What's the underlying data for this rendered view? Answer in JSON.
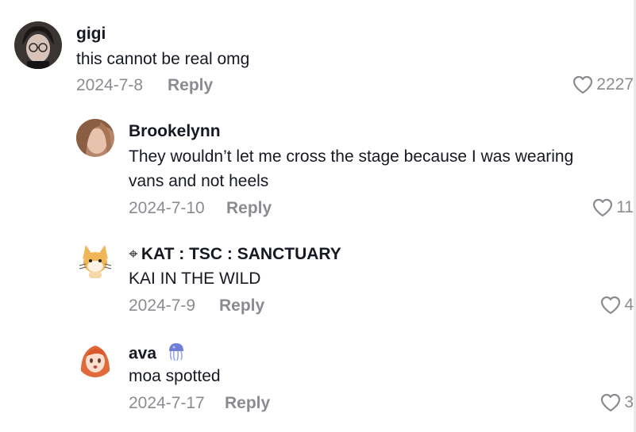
{
  "comments": [
    {
      "username": "gigi",
      "text": "this cannot be real omg",
      "date": "2024-7-8",
      "reply_label": "Reply",
      "likes": "2227",
      "avatar_icon": "person-photo-avatar"
    },
    {
      "username": "Brookelynn",
      "text": "They wouldn’t let me cross the stage because I was wearing vans and not heels",
      "date": "2024-7-10",
      "reply_label": "Reply",
      "likes": "11",
      "avatar_icon": "person-photo-avatar"
    },
    {
      "username": "KAT : TSC : SANCTUARY",
      "username_prefix_glyph": "⌖",
      "text": "KAI IN THE WILD",
      "date": "2024-7-9",
      "reply_label": "Reply",
      "likes": "4",
      "avatar_icon": "cartoon-fox-avatar"
    },
    {
      "username": "ava",
      "username_emoji": "jellyfish-emoji",
      "text": "moa spotted",
      "date": "2024-7-17",
      "reply_label": "Reply",
      "likes": "3",
      "avatar_icon": "anime-girl-avatar"
    }
  ],
  "colors": {
    "primary_text": "#161823",
    "secondary_text": "#8a8b91",
    "background": "#ffffff"
  }
}
